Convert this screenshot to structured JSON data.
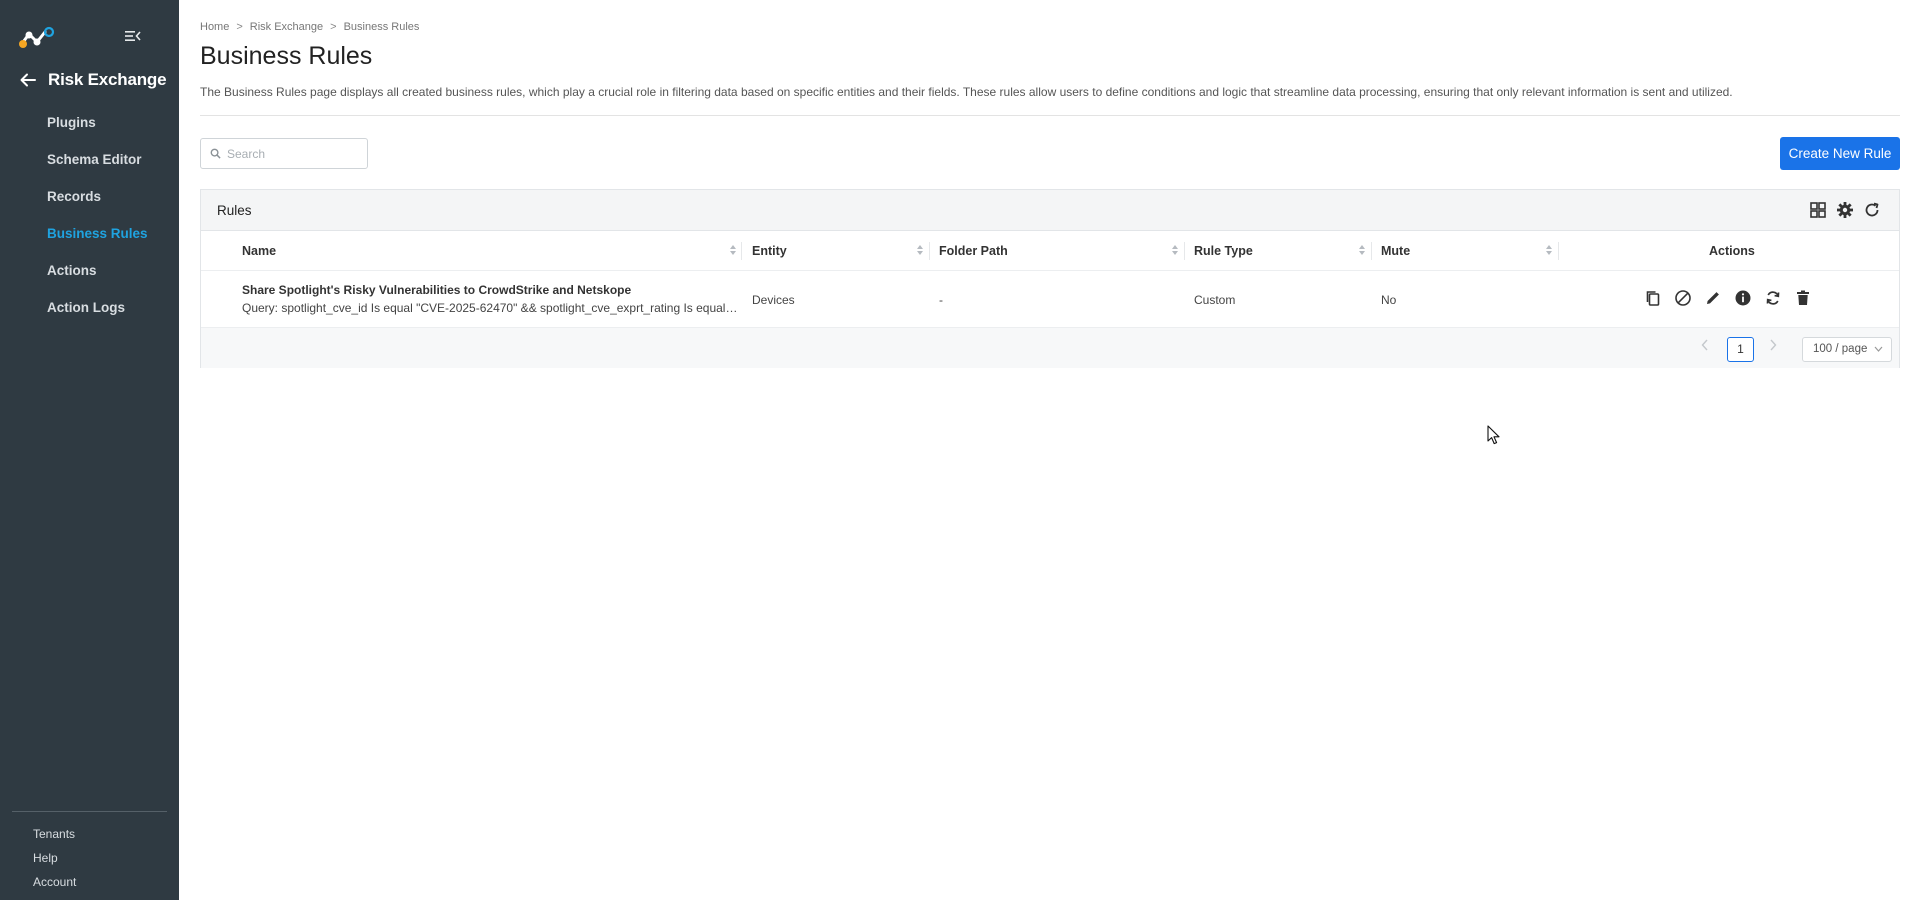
{
  "sidebar": {
    "title": "Risk Exchange",
    "items": [
      {
        "label": "Plugins"
      },
      {
        "label": "Schema Editor"
      },
      {
        "label": "Records"
      },
      {
        "label": "Business Rules",
        "active": true
      },
      {
        "label": "Actions"
      },
      {
        "label": "Action Logs"
      }
    ],
    "footer": [
      {
        "label": "Tenants"
      },
      {
        "label": "Help"
      },
      {
        "label": "Account"
      }
    ],
    "icons": {
      "logo": "company-logo",
      "collapse": "collapse-menu-icon",
      "back": "arrow-left-icon"
    }
  },
  "breadcrumb": {
    "items": [
      "Home",
      "Risk Exchange",
      "Business Rules"
    ],
    "separator": ">"
  },
  "page": {
    "title": "Business Rules",
    "description": "The Business Rules page displays all created business rules, which play a crucial role in filtering data based on specific entities and their fields. These rules allow users to define conditions and logic that streamline data processing, ensuring that only relevant information is sent and utilized."
  },
  "search": {
    "placeholder": "Search",
    "value": ""
  },
  "create_button": {
    "label": "Create New Rule"
  },
  "table": {
    "title": "Rules",
    "toolbar_icons": [
      "grid-view-icon",
      "settings-gear-icon",
      "refresh-icon"
    ],
    "columns": [
      "Name",
      "Entity",
      "Folder Path",
      "Rule Type",
      "Mute",
      "Actions"
    ],
    "rows": [
      {
        "name": "Share Spotlight's Risky Vulnerabilities to CrowdStrike and Netskope",
        "query": "Query: spotlight_cve_id Is equal \"CVE-2025-62470\" && spotlight_cve_exprt_rating Is equal \"Critical\"",
        "entity": "Devices",
        "folder_path": "-",
        "rule_type": "Custom",
        "mute": "No",
        "actions": [
          "copy-icon",
          "disable-icon",
          "edit-icon",
          "info-icon",
          "sync-icon",
          "delete-icon"
        ]
      }
    ],
    "pagination": {
      "current_page": "1",
      "page_size": "100 / page"
    }
  },
  "colors": {
    "sidebar_bg": "#2f3a42",
    "active_nav": "#1fa3e0",
    "primary": "#1a73e8"
  }
}
